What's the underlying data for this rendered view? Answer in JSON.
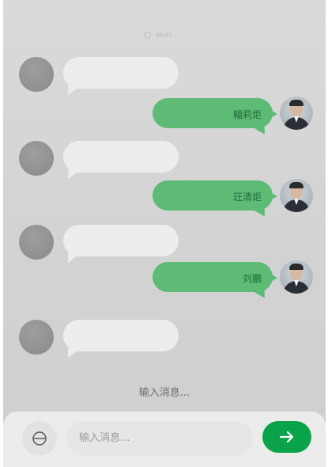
{
  "status": {
    "time_text": "09:41"
  },
  "messages": [
    {
      "side": "in",
      "text": ""
    },
    {
      "side": "out",
      "text": "輻莉炬"
    },
    {
      "side": "in",
      "text": ""
    },
    {
      "side": "out",
      "text": "玨清炬"
    },
    {
      "side": "in",
      "text": ""
    },
    {
      "side": "out",
      "text": "刘鵬"
    },
    {
      "side": "in",
      "text": ""
    }
  ],
  "composer": {
    "hint_text": "输入消息...",
    "placeholder": "输入消息...",
    "emoji_icon": "emoji-toggle-icon",
    "send_icon": "arrow-right-icon"
  },
  "colors": {
    "outgoing_bubble": "#5dbb75",
    "incoming_bubble": "#ededed",
    "send_button": "#0aa34a"
  }
}
